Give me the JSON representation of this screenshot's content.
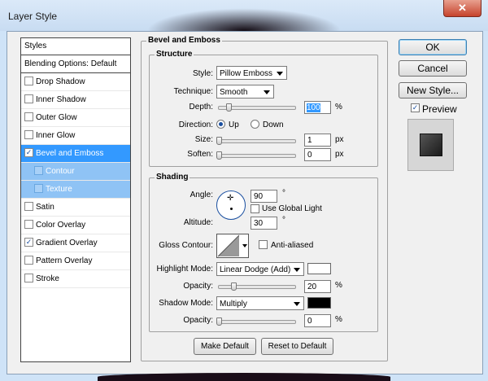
{
  "window": {
    "title": "Layer Style",
    "close_icon": "close-icon"
  },
  "styles_panel": {
    "header": "Styles",
    "blending": "Blending Options: Default",
    "items": [
      {
        "label": "Drop Shadow",
        "checked": false
      },
      {
        "label": "Inner Shadow",
        "checked": false
      },
      {
        "label": "Outer Glow",
        "checked": false
      },
      {
        "label": "Inner Glow",
        "checked": false
      },
      {
        "label": "Bevel and Emboss",
        "checked": true,
        "selected": true
      },
      {
        "label": "Contour",
        "checked": false,
        "sub": true
      },
      {
        "label": "Texture",
        "checked": false,
        "sub": true
      },
      {
        "label": "Satin",
        "checked": false
      },
      {
        "label": "Color Overlay",
        "checked": false
      },
      {
        "label": "Gradient Overlay",
        "checked": true
      },
      {
        "label": "Pattern Overlay",
        "checked": false
      },
      {
        "label": "Stroke",
        "checked": false
      }
    ]
  },
  "bevel": {
    "title": "Bevel and Emboss",
    "structure": {
      "title": "Structure",
      "style_label": "Style:",
      "style_value": "Pillow Emboss",
      "technique_label": "Technique:",
      "technique_value": "Smooth",
      "depth_label": "Depth:",
      "depth_value": "100",
      "depth_unit": "%",
      "direction_label": "Direction:",
      "dir_up": "Up",
      "dir_down": "Down",
      "direction_selected": "Up",
      "size_label": "Size:",
      "size_value": "1",
      "size_unit": "px",
      "soften_label": "Soften:",
      "soften_value": "0",
      "soften_unit": "px"
    },
    "shading": {
      "title": "Shading",
      "angle_label": "Angle:",
      "angle_value": "90",
      "angle_unit": "°",
      "global_light_label": "Use Global Light",
      "global_light_checked": false,
      "altitude_label": "Altitude:",
      "altitude_value": "30",
      "altitude_unit": "°",
      "gloss_label": "Gloss Contour:",
      "anti_aliased_label": "Anti-aliased",
      "anti_aliased_checked": false,
      "highlight_mode_label": "Highlight Mode:",
      "highlight_mode_value": "Linear Dodge (Add)",
      "highlight_color": "#ffffff",
      "highlight_opacity_label": "Opacity:",
      "highlight_opacity_value": "20",
      "highlight_opacity_unit": "%",
      "shadow_mode_label": "Shadow Mode:",
      "shadow_mode_value": "Multiply",
      "shadow_color": "#000000",
      "shadow_opacity_label": "Opacity:",
      "shadow_opacity_value": "0",
      "shadow_opacity_unit": "%"
    },
    "make_default": "Make Default",
    "reset_default": "Reset to Default"
  },
  "actions": {
    "ok": "OK",
    "cancel": "Cancel",
    "new_style": "New Style...",
    "preview_label": "Preview",
    "preview_checked": true
  }
}
